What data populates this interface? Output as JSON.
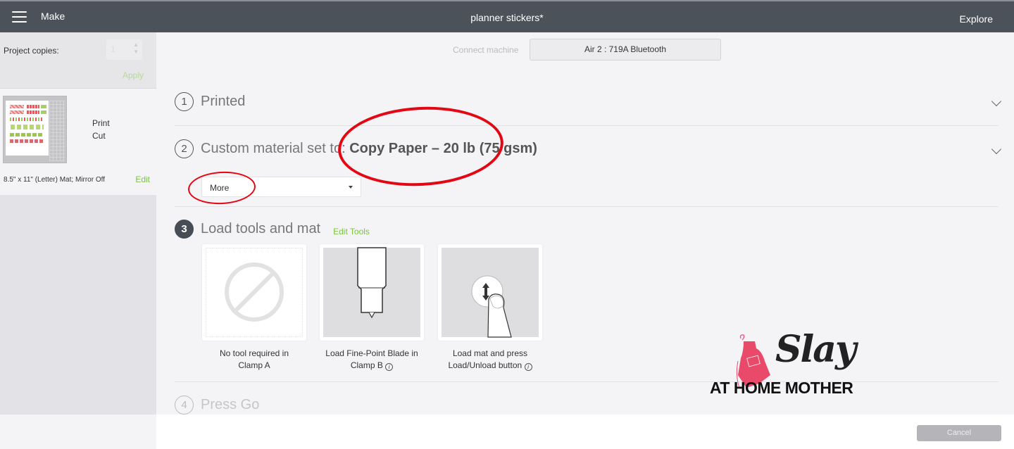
{
  "header": {
    "menu_icon": "hamburger-icon",
    "section": "Make",
    "title": "planner stickers*",
    "explore": "Explore"
  },
  "sidebar": {
    "project_copies_label": "Project copies:",
    "project_copies_value": "1",
    "apply_label": "Apply",
    "mat": {
      "operations": [
        "Print",
        "Cut"
      ],
      "description": "8.5\" x 11\" (Letter) Mat; Mirror Off",
      "edit_label": "Edit"
    }
  },
  "main": {
    "connect_label": "Connect machine",
    "machine": "Air 2 : 719A Bluetooth",
    "steps": [
      {
        "number": "1",
        "label": "Printed",
        "bold": ""
      },
      {
        "number": "2",
        "label": "Custom material set to: ",
        "bold": "Copy Paper – 20 lb (75 gsm)"
      },
      {
        "number": "3",
        "label": "Load tools and mat",
        "bold": ""
      },
      {
        "number": "4",
        "label": "Press Go",
        "bold": ""
      }
    ],
    "material_select": {
      "value": "More"
    },
    "edit_tools_label": "Edit Tools",
    "tools": [
      {
        "icon": "no-tool-icon",
        "caption_line1": "No tool required in",
        "caption_line2": "Clamp A",
        "info": false
      },
      {
        "icon": "fine-point-blade-icon",
        "caption_line1": "Load Fine-Point Blade in",
        "caption_line2": "Clamp B",
        "info": true
      },
      {
        "icon": "load-unload-button-icon",
        "caption_line1": "Load mat and press",
        "caption_line2": "Load/Unload button",
        "info": true
      }
    ]
  },
  "footer": {
    "cancel_label": "Cancel"
  },
  "watermark": {
    "line1": "Slay",
    "line2": "AT HOME MOTHER"
  },
  "colors": {
    "accent_green": "#7cc242",
    "header_bg": "#4b5259",
    "annotation_red": "#e30613",
    "logo_pink": "#ea4a6a"
  }
}
